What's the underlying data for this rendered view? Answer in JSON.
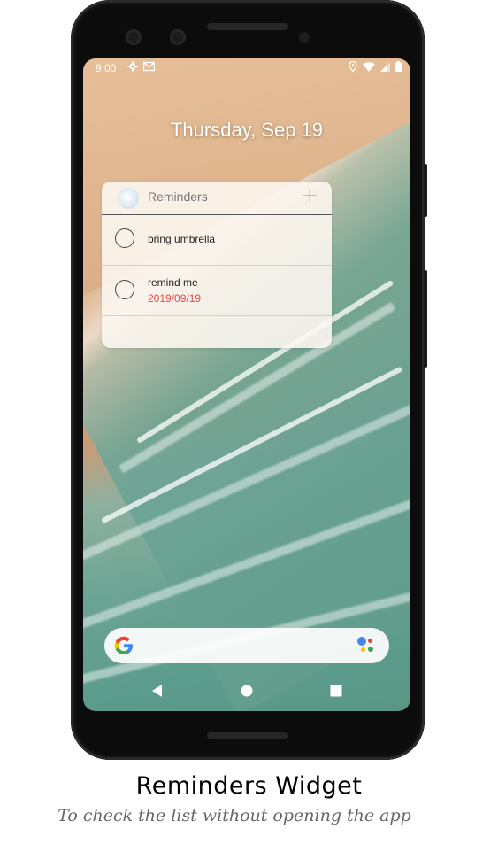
{
  "status_bar": {
    "time": "9:00",
    "left_icons": [
      "gear-icon",
      "mail-icon"
    ],
    "right_icons": [
      "location-icon",
      "wifi-icon",
      "signal-icon",
      "battery-icon"
    ]
  },
  "lock_screen": {
    "date": "Thursday, Sep 19"
  },
  "widget": {
    "title": "Reminders",
    "add_label": "+",
    "items": [
      {
        "text": "bring umbrella",
        "date": ""
      },
      {
        "text": "remind me",
        "date": "2019/09/19"
      }
    ],
    "date_color": "#e24848"
  },
  "search_bar": {
    "logo": "google-g-icon",
    "assistant": "assistant-icon"
  },
  "nav_bar": [
    "back-icon",
    "home-icon",
    "recents-icon"
  ],
  "caption": {
    "title": "Reminders Widget",
    "subtitle": "To check the list without opening the app"
  }
}
